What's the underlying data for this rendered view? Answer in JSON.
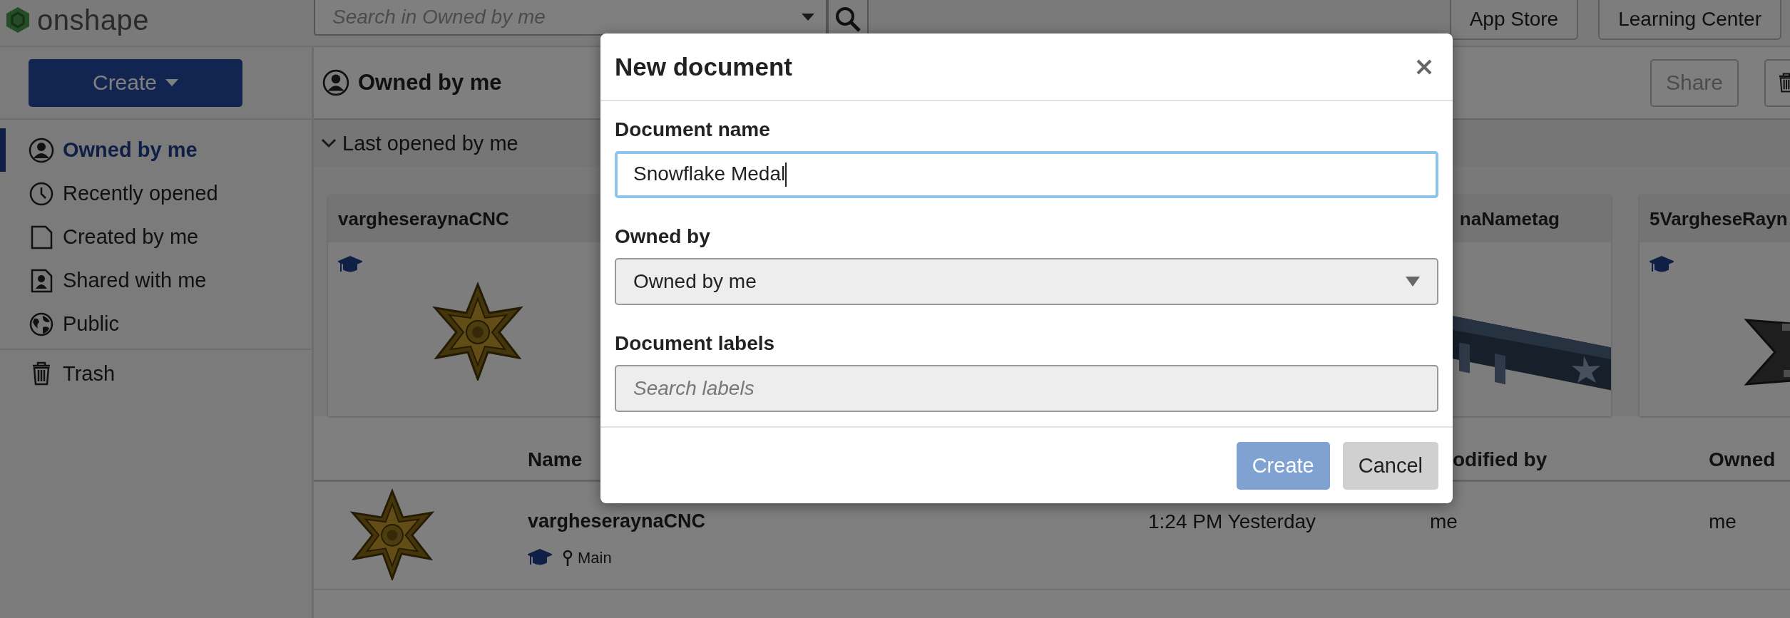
{
  "topbar": {
    "logo": "onshape",
    "search": {
      "placeholder": "Search in Owned by me"
    },
    "buttons": [
      "App Store",
      "Learning Center"
    ]
  },
  "sidebar": {
    "create_button": "Create",
    "items": [
      {
        "label": "Owned by me",
        "kind": "person",
        "selected": true
      },
      {
        "label": "Recently opened",
        "kind": "clock",
        "selected": false
      },
      {
        "label": "Created by me",
        "kind": "page",
        "selected": false
      },
      {
        "label": "Shared with me",
        "kind": "shared",
        "selected": false
      },
      {
        "label": "Public",
        "kind": "globe",
        "selected": false
      },
      {
        "label": "Trash",
        "kind": "trash",
        "selected": false
      }
    ]
  },
  "main": {
    "title": "Owned by me",
    "share_button": "Share",
    "section": {
      "title": "Last opened by me",
      "expanded": true
    },
    "cards": [
      {
        "title": "vargheseraynaCNC",
        "kind": "medal",
        "covered": false,
        "education": true
      },
      {
        "title": "naNametag",
        "kind": "tag",
        "covered": true
      },
      {
        "title": "5VargheseRayn",
        "kind": "flake",
        "covered": false,
        "education": true
      }
    ],
    "table": {
      "columns": [
        "Name",
        "odified by",
        "Owned"
      ],
      "rows": [
        {
          "name": "vargheseraynaCNC",
          "education": true,
          "branch": "Main",
          "modified": "1:24 PM Yesterday",
          "modified_by": "me",
          "owned_by": "me"
        }
      ]
    }
  },
  "dialog": {
    "title": "New document",
    "fields": [
      {
        "label": "Document name",
        "kind": "text",
        "value": "Snowflake Medal",
        "focused": true
      },
      {
        "label": "Owned by",
        "kind": "select",
        "value": "Owned by me"
      },
      {
        "label": "Document labels",
        "kind": "text",
        "placeholder": "Search labels",
        "focused": false
      }
    ],
    "buttons": [
      {
        "label": "Create",
        "kind": "primary"
      },
      {
        "label": "Cancel",
        "kind": "secondary"
      }
    ]
  }
}
